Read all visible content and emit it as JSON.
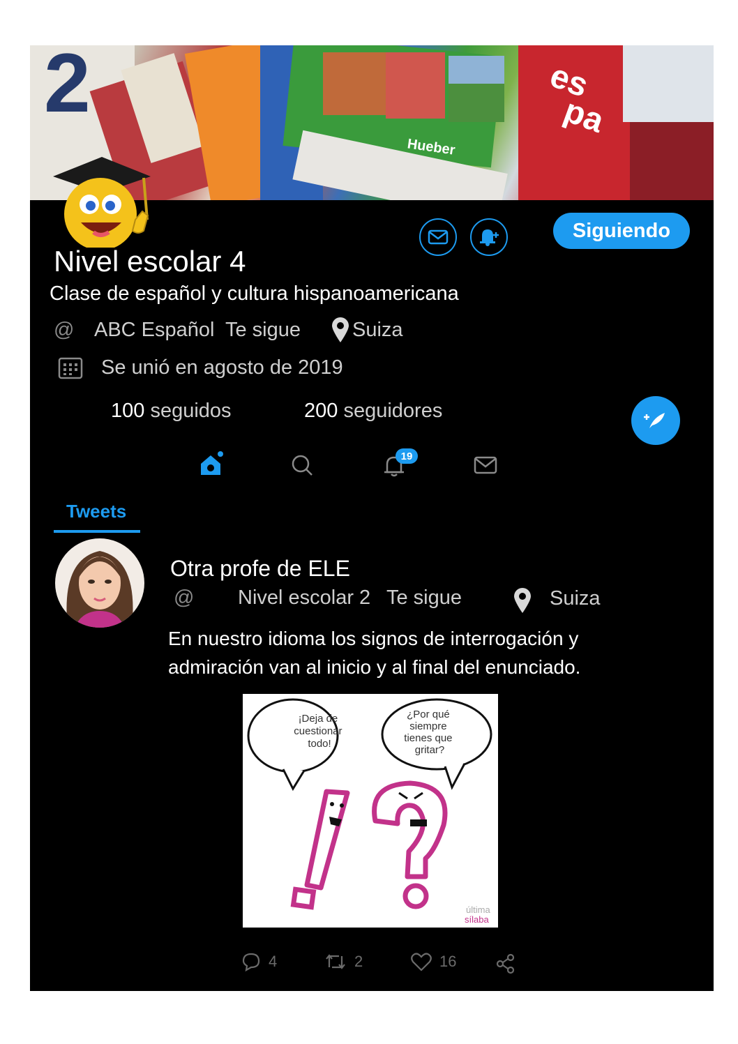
{
  "profile": {
    "name": "Nivel escolar 4",
    "bio": "Clase de español y cultura hispanoamericana",
    "handle_prefix": "@",
    "handle_name": "ABC Español",
    "follows_you": "Te sigue",
    "location": "Suiza",
    "joined": "Se unió en agosto de 2019",
    "following_count": "100",
    "following_label": "seguidos",
    "followers_count": "200",
    "followers_label": "seguidores",
    "follow_button": "Siguiendo"
  },
  "nav": {
    "notifications_badge": "19"
  },
  "tabs": {
    "active": "Tweets"
  },
  "tweet": {
    "author": "Otra profe de ELE",
    "handle_prefix": "@",
    "handle_name": "Nivel escolar 2",
    "follows_you": "Te sigue",
    "location": "Suiza",
    "text": "En nuestro idioma los signos de interrogación y admiración van al inicio y al final del enunciado.",
    "image": {
      "bubble_left": [
        "¡Deja de",
        "cuestionar",
        "todo!"
      ],
      "bubble_right": [
        "¿Por qué",
        "siempre",
        "tienes que",
        "gritar?"
      ],
      "watermark": [
        "última",
        "sílaba"
      ]
    },
    "replies": "4",
    "retweets": "2",
    "likes": "16"
  },
  "colors": {
    "accent": "#1d9bf0",
    "background": "#000000",
    "pink": "#c2328a"
  },
  "icons": [
    "envelope-icon",
    "bell-plus-icon",
    "at-icon",
    "location-pin-icon",
    "calendar-icon",
    "compose-feather-icon",
    "home-icon",
    "search-icon",
    "bell-icon",
    "mail-icon",
    "reply-icon",
    "retweet-icon",
    "heart-icon",
    "share-icon"
  ]
}
